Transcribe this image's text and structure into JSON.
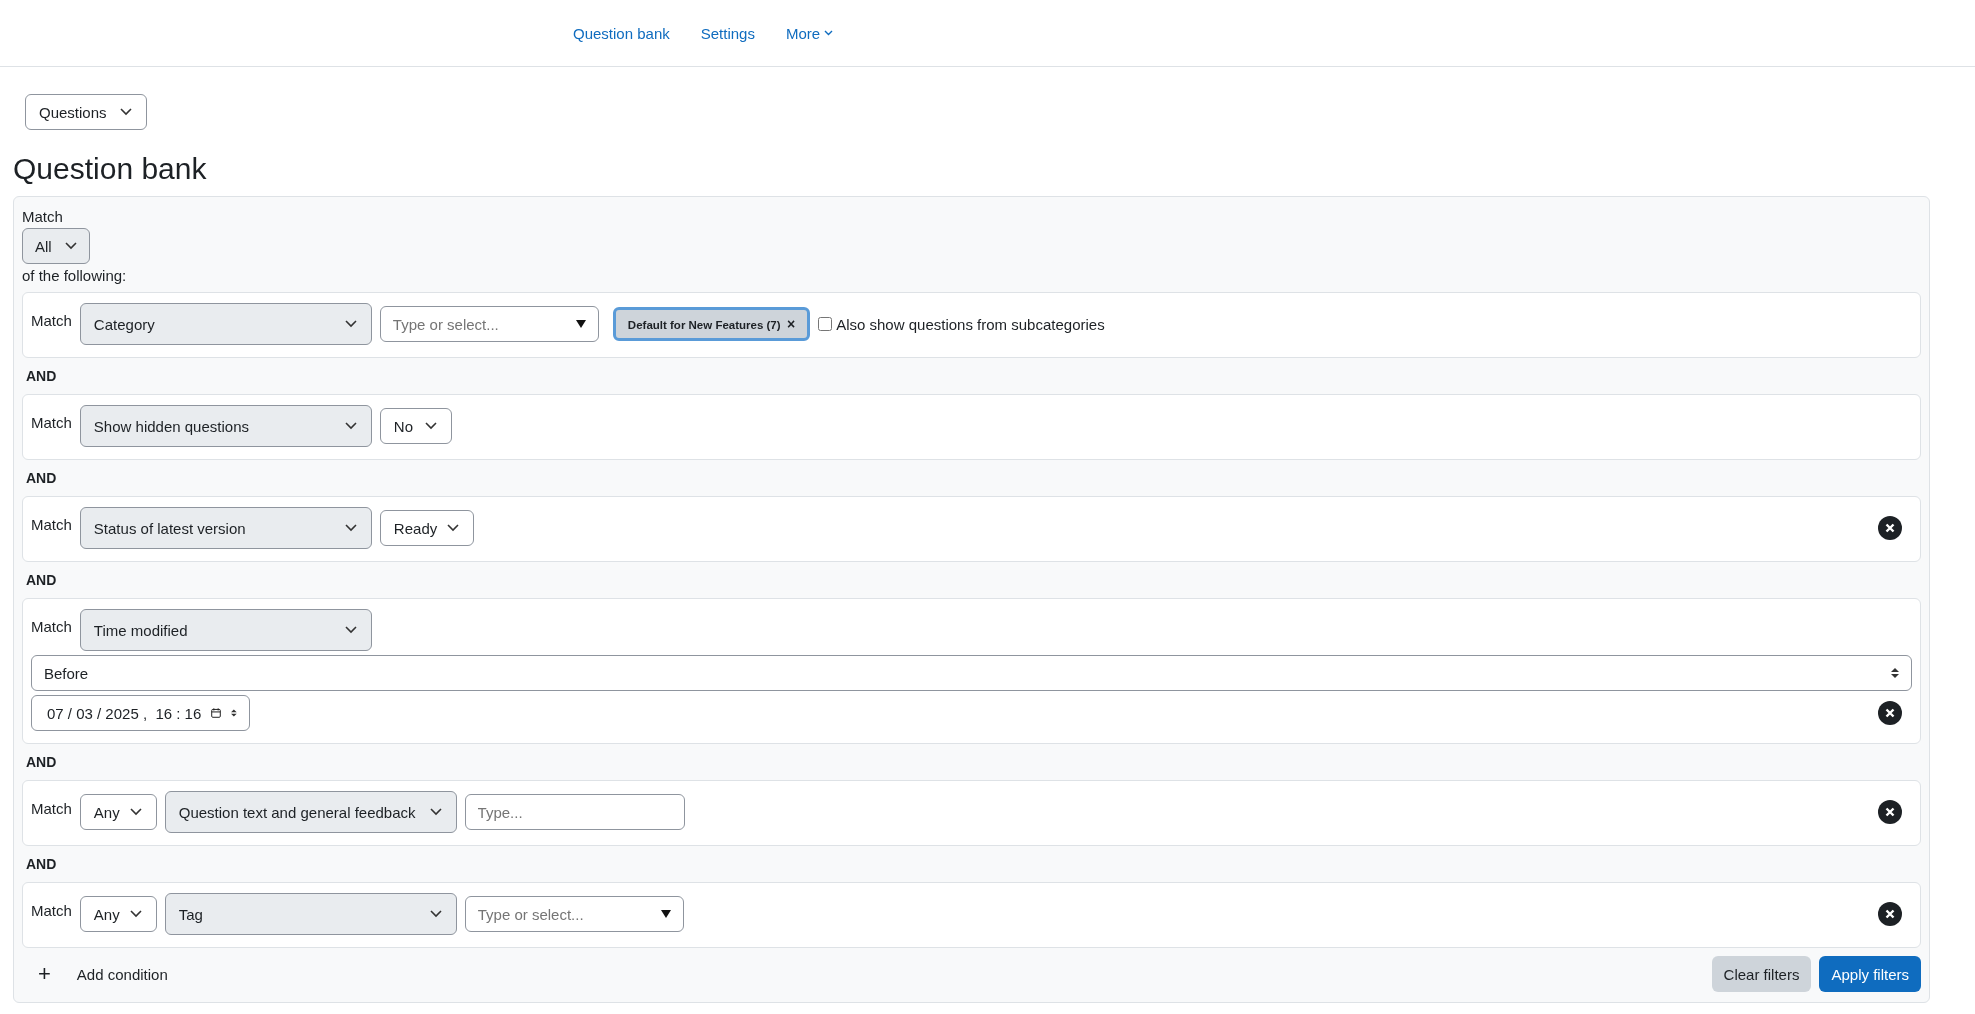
{
  "nav": {
    "links": [
      {
        "label": "Question bank",
        "dropdown": false
      },
      {
        "label": "Settings",
        "dropdown": false
      },
      {
        "label": "More",
        "dropdown": true
      }
    ]
  },
  "page_select": {
    "value": "Questions"
  },
  "heading": "Question bank",
  "filters": {
    "match_label": "Match",
    "join": {
      "value": "All"
    },
    "suffix": "of the following:",
    "conditions": [
      {
        "kind": "inline",
        "label": "Match",
        "removable": false,
        "controls": [
          {
            "kind": "field-select",
            "value": "Category"
          },
          {
            "kind": "autocomplete",
            "placeholder": "Type or select..."
          },
          {
            "kind": "chip",
            "label": "Default for New Features (7)",
            "remove": "×"
          },
          {
            "kind": "checkbox",
            "label": "Also show questions from subcategories",
            "checked": false
          }
        ]
      },
      {
        "kind": "inline",
        "separator": "AND",
        "label": "Match",
        "removable": false,
        "controls": [
          {
            "kind": "field-select",
            "value": "Show hidden questions"
          },
          {
            "kind": "select",
            "value": "No"
          }
        ]
      },
      {
        "kind": "inline",
        "separator": "AND",
        "label": "Match",
        "removable": true,
        "controls": [
          {
            "kind": "field-select",
            "value": "Status of latest version"
          },
          {
            "kind": "select",
            "value": "Ready"
          }
        ]
      },
      {
        "kind": "stacked",
        "separator": "AND",
        "label": "Match",
        "removable": true,
        "controls": [
          {
            "kind": "field-select",
            "value": "Time modified"
          },
          {
            "kind": "native-select",
            "value": "Before"
          },
          {
            "kind": "datetime",
            "value": "07 / 03 / 2025 ,  16 : 16"
          }
        ]
      },
      {
        "kind": "inline",
        "separator": "AND",
        "label": "Match",
        "removable": true,
        "controls": [
          {
            "kind": "select",
            "value": "Any"
          },
          {
            "kind": "field-select",
            "value": "Question text and general feedback"
          },
          {
            "kind": "text",
            "placeholder": "Type..."
          }
        ]
      },
      {
        "kind": "inline",
        "separator": "AND",
        "label": "Match",
        "removable": true,
        "controls": [
          {
            "kind": "select",
            "value": "Any"
          },
          {
            "kind": "field-select",
            "value": "Tag"
          },
          {
            "kind": "autocomplete",
            "placeholder": "Type or select..."
          }
        ]
      }
    ],
    "add_condition": {
      "icon": "+",
      "label": "Add condition"
    },
    "buttons": [
      {
        "kind": "secondary",
        "label": "Clear filters"
      },
      {
        "kind": "primary",
        "label": "Apply filters"
      }
    ]
  }
}
